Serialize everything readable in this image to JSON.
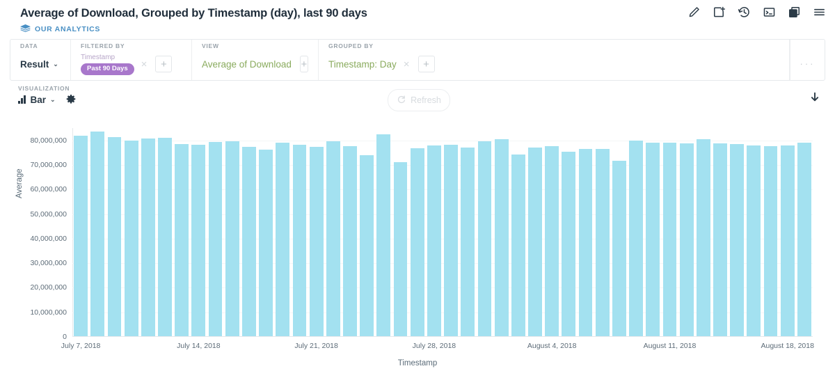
{
  "header": {
    "title": "Average of Download, Grouped by Timestamp (day), last 90 days",
    "subtitle": "OUR ANALYTICS",
    "actions": [
      {
        "name": "edit-icon",
        "label": "Edit"
      },
      {
        "name": "add-to-dashboard-icon",
        "label": "Add to dashboard"
      },
      {
        "name": "history-icon",
        "label": "Revision history"
      },
      {
        "name": "console-icon",
        "label": "View SQL"
      },
      {
        "name": "duplicate-icon",
        "label": "Duplicate"
      },
      {
        "name": "menu-icon",
        "label": "More"
      }
    ]
  },
  "querybar": {
    "data": {
      "label": "DATA",
      "value": "Result",
      "caret": "⌄"
    },
    "filtered_by": {
      "label": "FILTERED BY",
      "field": "Timestamp",
      "pill": "Past 90 Days",
      "remove": "×",
      "add": "+"
    },
    "view": {
      "label": "VIEW",
      "value": "Average of Download",
      "add": "+"
    },
    "grouped_by": {
      "label": "GROUPED BY",
      "value": "Timestamp: Day",
      "remove": "×",
      "add": "+"
    },
    "overflow": "···"
  },
  "visualization": {
    "label": "VISUALIZATION",
    "type": "Bar",
    "caret": "⌄",
    "settings_icon": "gear-icon",
    "refresh_label": "Refresh",
    "download_icon": "download-icon"
  },
  "colors": {
    "bar": "#a3e1f0",
    "accent_link": "#4a90c4",
    "filter_pill": "#a877cb",
    "view_term": "#8aab5e",
    "axis_text": "#5c6b77",
    "gridline": "#f4f6f7"
  },
  "chart_data": {
    "type": "bar",
    "title": "Average of Download, Grouped by Timestamp (day), last 90 days",
    "xlabel": "Timestamp",
    "ylabel": "Average",
    "ylim": [
      0,
      85000000
    ],
    "grid": true,
    "legend": false,
    "ytick_labels": [
      "0",
      "10,000,000",
      "20,000,000",
      "30,000,000",
      "40,000,000",
      "50,000,000",
      "60,000,000",
      "70,000,000",
      "80,000,000"
    ],
    "ytick_values": [
      0,
      10000000,
      20000000,
      30000000,
      40000000,
      50000000,
      60000000,
      70000000,
      80000000
    ],
    "xtick_labels": [
      "July 7, 2018",
      "July 14, 2018",
      "July 21, 2018",
      "July 28, 2018",
      "August 4, 2018",
      "August 11, 2018",
      "August 18, 2018"
    ],
    "xtick_indices": [
      0,
      7,
      14,
      21,
      28,
      35,
      42
    ],
    "categories": [
      "July 7, 2018",
      "July 8, 2018",
      "July 9, 2018",
      "July 10, 2018",
      "July 11, 2018",
      "July 12, 2018",
      "July 13, 2018",
      "July 14, 2018",
      "July 15, 2018",
      "July 16, 2018",
      "July 17, 2018",
      "July 18, 2018",
      "July 19, 2018",
      "July 20, 2018",
      "July 21, 2018",
      "July 22, 2018",
      "July 23, 2018",
      "July 24, 2018",
      "July 25, 2018",
      "July 26, 2018",
      "July 27, 2018",
      "July 28, 2018",
      "July 29, 2018",
      "July 30, 2018",
      "July 31, 2018",
      "August 1, 2018",
      "August 2, 2018",
      "August 3, 2018",
      "August 4, 2018",
      "August 5, 2018",
      "August 6, 2018",
      "August 7, 2018",
      "August 8, 2018",
      "August 9, 2018",
      "August 10, 2018",
      "August 11, 2018",
      "August 12, 2018",
      "August 13, 2018",
      "August 14, 2018",
      "August 15, 2018",
      "August 16, 2018",
      "August 17, 2018",
      "August 18, 2018",
      "August 19, 2018"
    ],
    "values": [
      81500000,
      83200000,
      81000000,
      79700000,
      80500000,
      80700000,
      78300000,
      77900000,
      79000000,
      79200000,
      77200000,
      76000000,
      78700000,
      77900000,
      77000000,
      79300000,
      77400000,
      73700000,
      82100000,
      70900000,
      76400000,
      77600000,
      78000000,
      76800000,
      79400000,
      80100000,
      74000000,
      76900000,
      77300000,
      75000000,
      76100000,
      76300000,
      71400000,
      79500000,
      78900000,
      78800000,
      78600000,
      80200000,
      78400000,
      78300000,
      77500000,
      77300000,
      77600000,
      78900000
    ]
  }
}
